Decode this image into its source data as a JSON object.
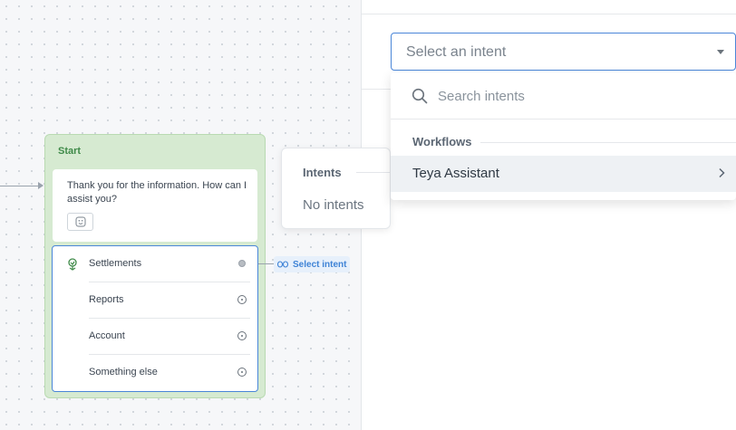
{
  "canvas": {
    "start_block": {
      "title": "Start",
      "message": "Thank you for the information. How can I assist you?",
      "choices": [
        {
          "label": "Settlements"
        },
        {
          "label": "Reports"
        },
        {
          "label": "Account"
        },
        {
          "label": "Something else"
        }
      ]
    },
    "select_intent_label": "Select intent",
    "intents_popover": {
      "title": "Intents",
      "empty_text": "No intents"
    }
  },
  "intent_select": {
    "placeholder": "Select an intent",
    "search_placeholder": "Search intents",
    "groups": [
      {
        "label": "Workflows",
        "options": [
          {
            "label": "Teya Assistant"
          }
        ]
      }
    ]
  },
  "colors": {
    "accent": "#4a86d8",
    "start_block_bg": "#d6ead1",
    "start_title": "#3f8a49",
    "select_intent_text": "#3f83d6"
  },
  "icons": {
    "branch": "branch-icon",
    "message_action": "emoji-icon",
    "search": "search-icon",
    "chevron": "chevron-right-icon",
    "caret": "caret-down-icon",
    "intent_link": "link-icon"
  }
}
